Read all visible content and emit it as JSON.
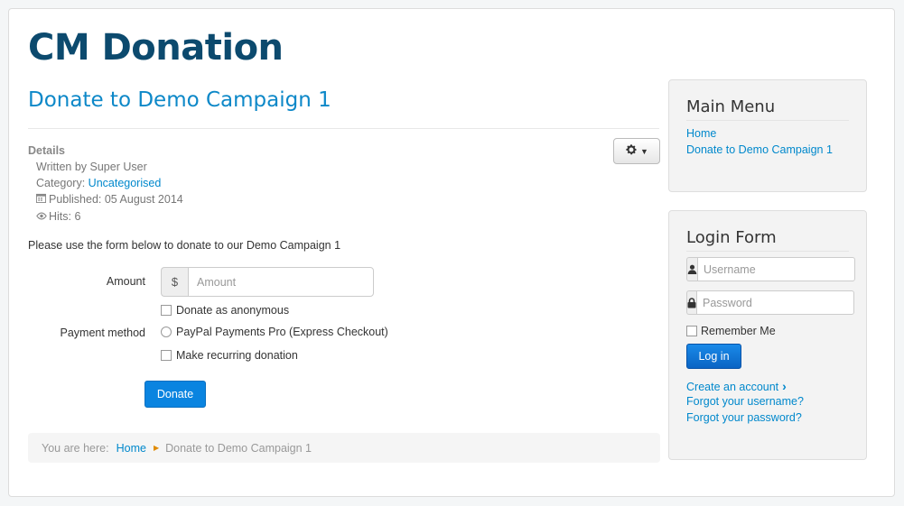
{
  "site": {
    "title": "CM Donation"
  },
  "article": {
    "title": "Donate to Demo Campaign 1",
    "details": {
      "heading": "Details",
      "written_by": "Written by Super User",
      "category_label": "Category: ",
      "category_value": "Uncategorised",
      "published": "Published: 05 August 2014",
      "hits": "Hits: 6"
    },
    "intro": "Please use the form below to donate to our Demo Campaign 1"
  },
  "form": {
    "amount_label": "Amount",
    "currency_symbol": "$",
    "amount_placeholder": "Amount",
    "amount_value": "",
    "anonymous_label": "Donate as anonymous",
    "payment_method_label": "Payment method",
    "payment_option": "PayPal Payments Pro (Express Checkout)",
    "recurring_label": "Make recurring donation",
    "submit_label": "Donate"
  },
  "breadcrumb": {
    "prefix": "You are here:",
    "items": [
      "Home",
      "Donate to Demo Campaign 1"
    ]
  },
  "sidebar": {
    "main_menu": {
      "title": "Main Menu",
      "items": [
        "Home",
        "Donate to Demo Campaign 1"
      ]
    },
    "login": {
      "title": "Login Form",
      "username_placeholder": "Username",
      "password_placeholder": "Password",
      "remember_label": "Remember Me",
      "submit_label": "Log in",
      "links": [
        "Create an account",
        "Forgot your username?",
        "Forgot your password?"
      ]
    }
  },
  "colors": {
    "site_title": "#0c4a6e",
    "link": "#0088cc",
    "primary_button": "#0a84e0"
  },
  "icons": [
    "gear-icon",
    "calendar-icon",
    "eye-icon",
    "user-icon",
    "lock-icon",
    "chevron-right-icon",
    "caret-down-icon"
  ]
}
